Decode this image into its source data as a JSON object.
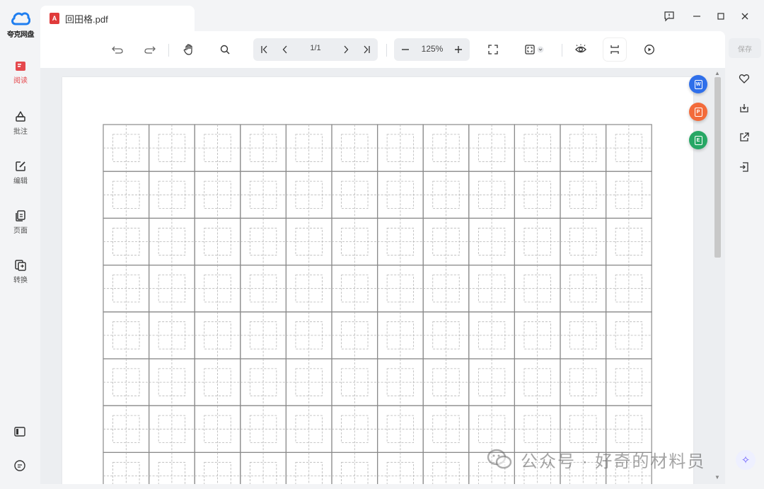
{
  "app": {
    "brand_name": "夸克网盘",
    "tab_title": "回田格.pdf",
    "pdf_badge": "A"
  },
  "left_nav": {
    "items": [
      {
        "label": "阅读",
        "active": true
      },
      {
        "label": "批注",
        "active": false
      },
      {
        "label": "编辑",
        "active": false
      },
      {
        "label": "页面",
        "active": false
      },
      {
        "label": "转换",
        "active": false
      }
    ]
  },
  "toolbar": {
    "page_indicator": "1/1",
    "zoom_level": "125%"
  },
  "right_rail": {
    "save_label": "保存"
  },
  "document": {
    "grid_columns": 12,
    "grid_rows_visible": 8
  },
  "watermark": {
    "text": "公众号 · 好奇的材料员"
  },
  "colors": {
    "active_nav": "#e5484d",
    "float_word": "#2f6fea",
    "float_pdf": "#f36b3b",
    "float_excel": "#27a765",
    "brand_blue": "#1f7ef0"
  }
}
